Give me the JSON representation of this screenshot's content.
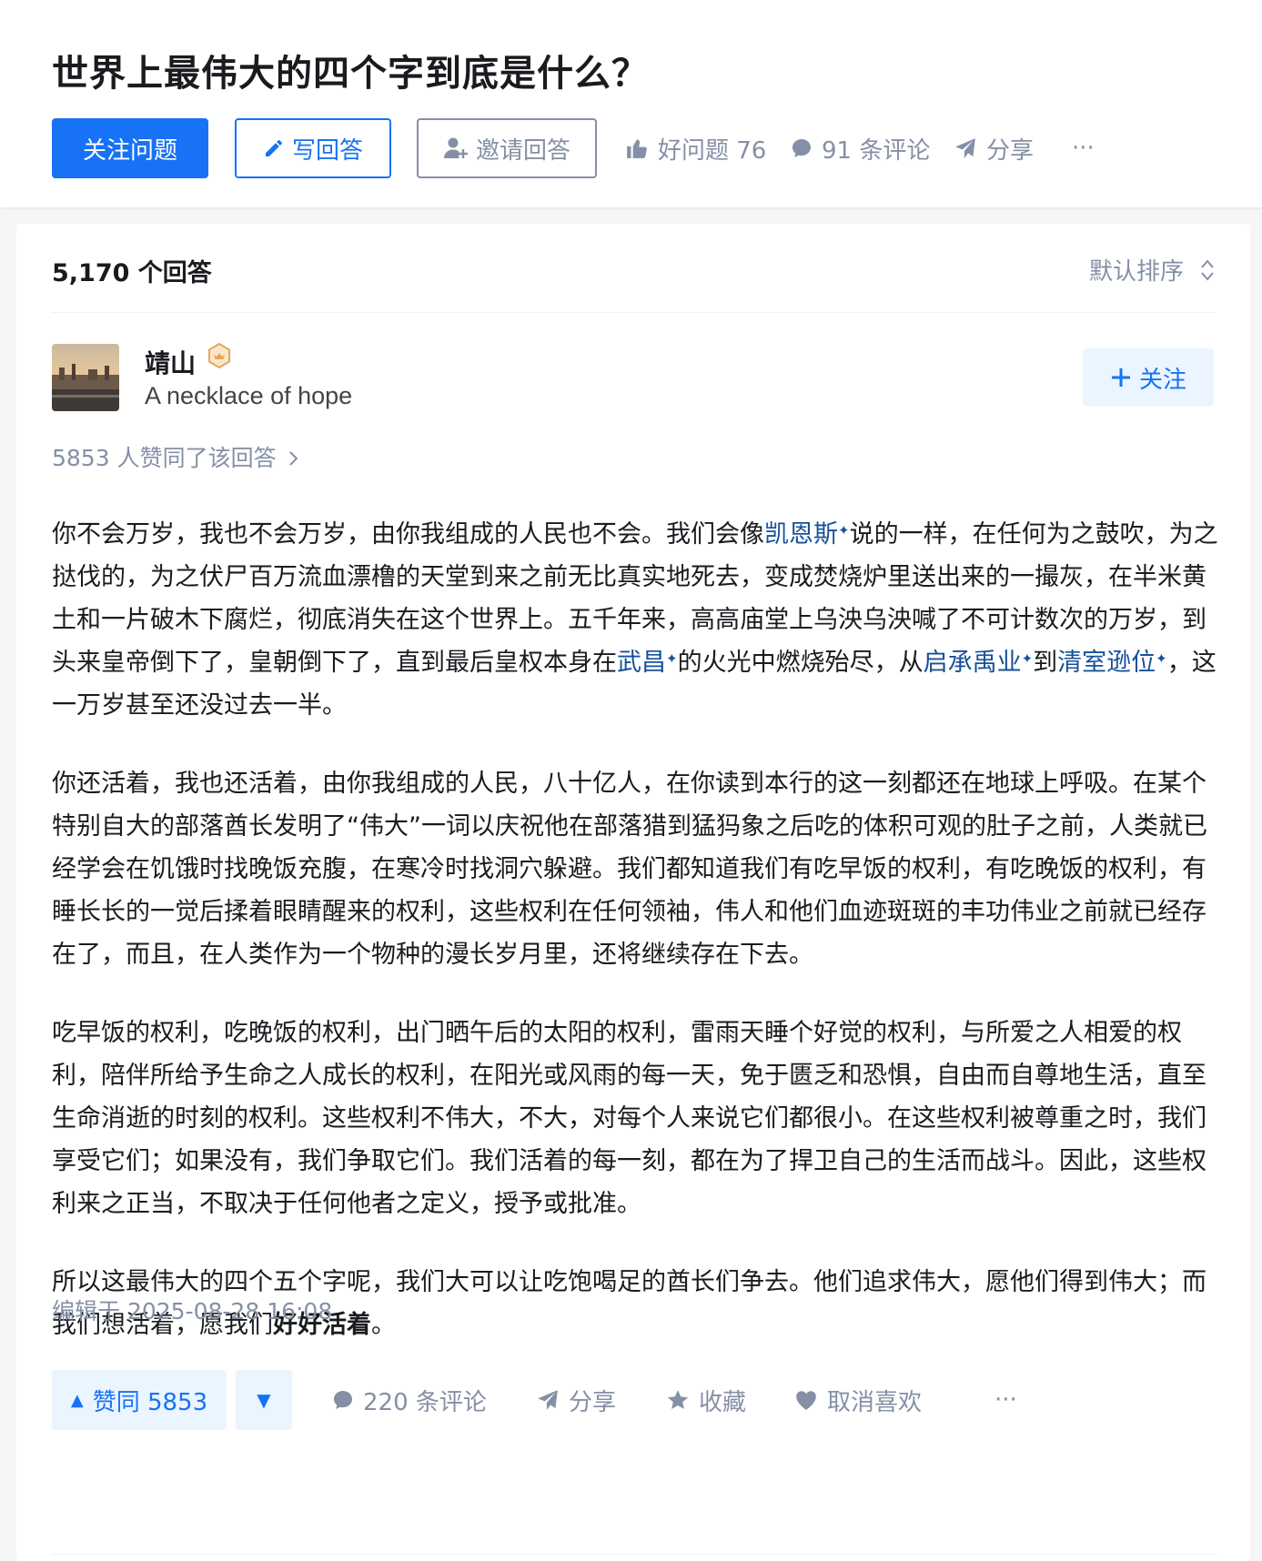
{
  "question": {
    "title": "世界上最伟大的四个字到底是什么？",
    "follow_label": "关注问题",
    "write_label": "写回答",
    "invite_label": "邀请回答",
    "good_question_label": "好问题 76",
    "comments_label": "91 条评论",
    "share_label": "分享",
    "more_label": "···"
  },
  "answers_bar": {
    "count_label": "5,170 个回答",
    "sort_label": "默认排序"
  },
  "answer": {
    "author_name": "靖山",
    "author_headline": "A necklace of hope",
    "follow_label": "关注",
    "voters_label": "5853 人赞同了该回答",
    "paragraphs": {
      "p1": {
        "t1": "你不会万岁，我也不会万岁，由你我组成的人民也不会。我们会像",
        "l1": "凯恩斯",
        "t2": "说的一样，在任何为之鼓吹，为之挞伐的，为之伏尸百万流血漂橹的天堂到来之前无比真实地死去，变成焚烧炉里送出来的一撮灰，在半米黄土和一片破木下腐烂，彻底消失在这个世界上。五千年来，高高庙堂上乌泱乌泱喊了不可计数次的万岁，到头来皇帝倒下了，皇朝倒下了，直到最后皇权本身在",
        "l2": "武昌",
        "t3": "的火光中燃烧殆尽，从",
        "l3": "启承禹业",
        "t4": "到",
        "l4": "清室逊位",
        "t5": "，这一万岁甚至还没过去一半。"
      },
      "p2": "你还活着，我也还活着，由你我组成的人民，八十亿人，在你读到本行的这一刻都还在地球上呼吸。在某个特别自大的部落酋长发明了“伟大”一词以庆祝他在部落猎到猛犸象之后吃的体积可观的肚子之前，人类就已经学会在饥饿时找晚饭充腹，在寒冷时找洞穴躲避。我们都知道我们有吃早饭的权利，有吃晚饭的权利，有睡长长的一觉后揉着眼睛醒来的权利，这些权利在任何领袖，伟人和他们血迹斑斑的丰功伟业之前就已经存在了，而且，在人类作为一个物种的漫长岁月里，还将继续存在下去。",
      "p3": "吃早饭的权利，吃晚饭的权利，出门晒午后的太阳的权利，雷雨天睡个好觉的权利，与所爱之人相爱的权利，陪伴所给予生命之人成长的权利，在阳光或风雨的每一天，免于匮乏和恐惧，自由而自尊地生活，直至生命消逝的时刻的权利。这些权利不伟大，不大，对每个人来说它们都很小。在这些权利被尊重之时，我们享受它们；如果没有，我们争取它们。我们活着的每一刻，都在为了捍卫自己的生活而战斗。因此，这些权利来之正当，不取决于任何他者之定义，授予或批准。",
      "p4": {
        "t1": "所以这最伟大的四个五个字呢，我们大可以让吃饱喝足的酋长们争去。他们追求伟大，愿他们得到伟大；而我们想活着，愿我们",
        "bold": "好好活着",
        "t2": "。"
      }
    },
    "link_mark": "✦",
    "edited_label": "编辑于 2025-08-28 16:08",
    "vote_up_label": "赞同 5853",
    "vote_up_icon": "▲",
    "vote_down_icon": "▼",
    "comments_label": "220 条评论",
    "share_label": "分享",
    "collect_label": "收藏",
    "unlike_label": "取消喜欢",
    "more_label": "···"
  },
  "colors": {
    "brand_blue": "#1772f6",
    "muted": "#8590a6",
    "link": "#175199",
    "light_blue_bg": "#ebf5ff"
  },
  "icons": [
    "pencil-icon",
    "add-user-icon",
    "thumbs-up-icon",
    "comment-icon",
    "share-icon",
    "sort-icon",
    "badge-icon",
    "plus-icon",
    "star-icon",
    "heart-icon",
    "chevron-right-icon"
  ]
}
